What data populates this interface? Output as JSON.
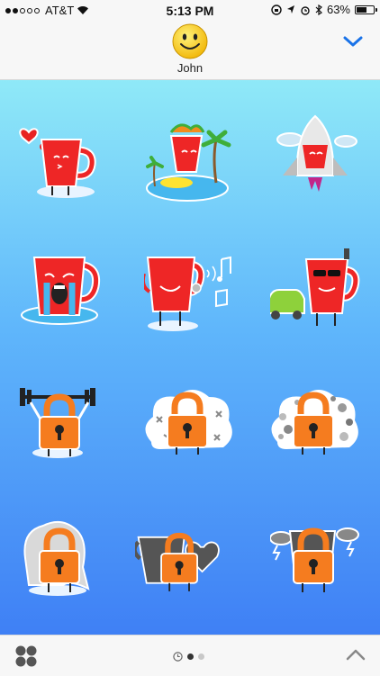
{
  "status": {
    "carrier": "AT&T",
    "time": "5:13 PM",
    "battery": "63%",
    "battery_level": 0.63
  },
  "header": {
    "contact_name": "John"
  },
  "colors": {
    "mug": "#ee2626",
    "lock": "#f57c1f",
    "accent": "#1a73e8"
  },
  "stickers": [
    {
      "kind": "mug-love"
    },
    {
      "kind": "mug-island"
    },
    {
      "kind": "mug-rocket"
    },
    {
      "kind": "mug-cry"
    },
    {
      "kind": "mug-sing"
    },
    {
      "kind": "mug-car"
    },
    {
      "kind": "lock-weights"
    },
    {
      "kind": "lock-cloud-x"
    },
    {
      "kind": "lock-cloud-dots"
    },
    {
      "kind": "lock-hair"
    },
    {
      "kind": "lock-heart"
    },
    {
      "kind": "lock-storm"
    }
  ],
  "pager": {
    "pages": 3,
    "current": 1
  }
}
